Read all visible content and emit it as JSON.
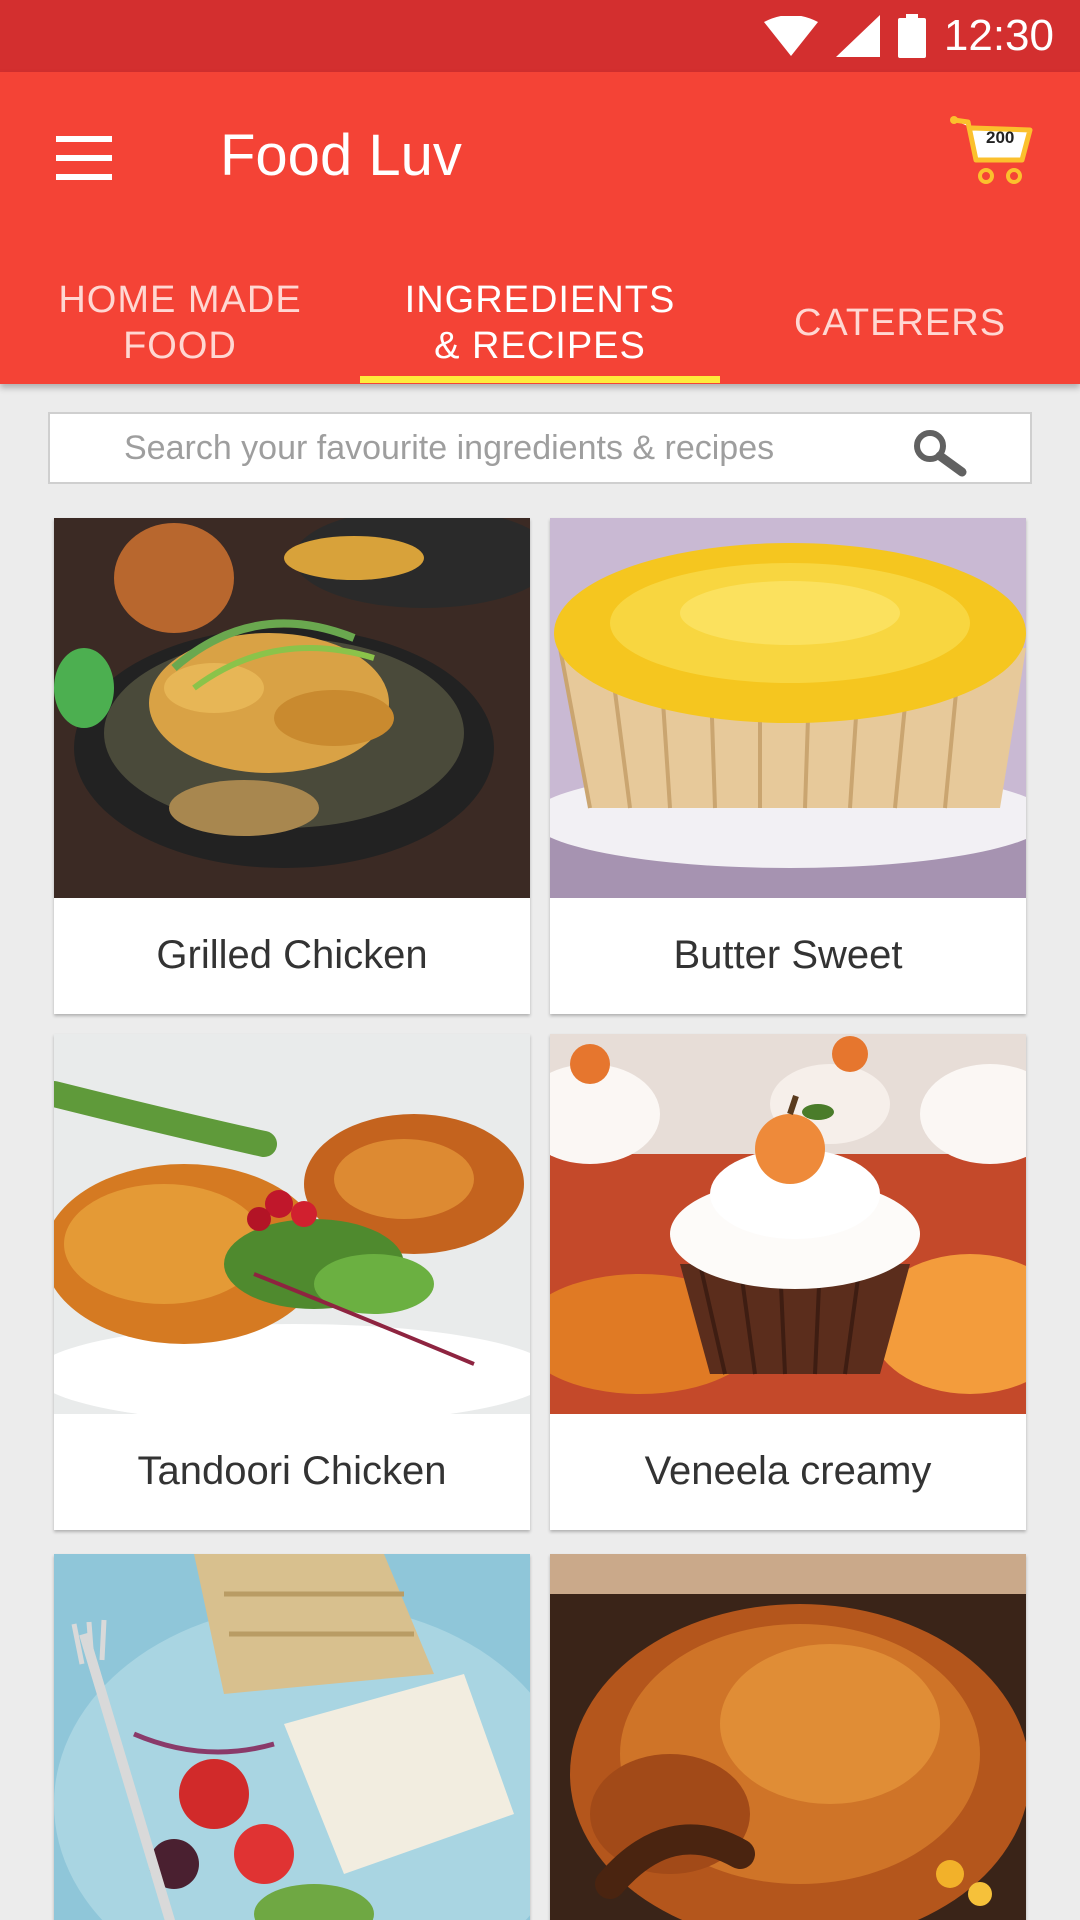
{
  "status_bar": {
    "time": "12:30"
  },
  "app_bar": {
    "title": "Food Luv",
    "cart_count": "200"
  },
  "tabs": [
    {
      "label": "HOME MADE\nFOOD",
      "active": false
    },
    {
      "label": "INGREDIENTS\n& RECIPES",
      "active": true
    },
    {
      "label": "CATERERS",
      "active": false
    }
  ],
  "search": {
    "placeholder": "Search your favourite ingredients & recipes"
  },
  "items": [
    {
      "name": "Grilled Chicken"
    },
    {
      "name": "Butter Sweet"
    },
    {
      "name": "Tandoori Chicken"
    },
    {
      "name": "Veneela creamy"
    },
    {
      "name": ""
    },
    {
      "name": ""
    }
  ],
  "colors": {
    "status_bar": "#d32f2f",
    "primary": "#f44336",
    "tab_indicator": "#ffeb3b",
    "background": "#ececec"
  }
}
